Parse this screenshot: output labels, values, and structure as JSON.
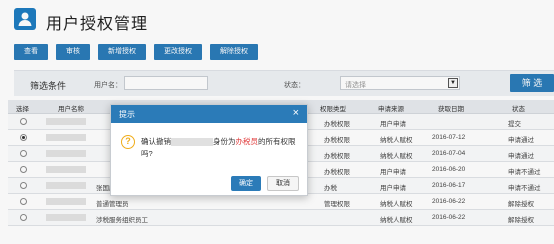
{
  "header": {
    "title": "用户授权管理"
  },
  "toolbar": {
    "buttons": [
      {
        "label": "查看"
      },
      {
        "label": "审核"
      },
      {
        "label": "新增授权"
      },
      {
        "label": "更改授权"
      },
      {
        "label": "解除授权"
      }
    ]
  },
  "filter": {
    "title": "筛选条件",
    "username_label": "用户名：",
    "username_value": "",
    "status_label": "状态：",
    "status_value": "请选择",
    "button": "筛 选"
  },
  "table": {
    "headers": [
      "选择",
      "用户名称",
      "",
      "",
      "",
      "",
      "权限类型",
      "申请来源",
      "获取日期",
      "状态"
    ],
    "rows": [
      {
        "selected": false,
        "name": "",
        "col3": "",
        "perm": "办税权限",
        "source": "用户申请",
        "date": "",
        "status": "提交"
      },
      {
        "selected": true,
        "name": "",
        "col3": "",
        "perm": "办税权限",
        "source": "纳税人赋权",
        "date": "2016-07-12",
        "status": "申请通过"
      },
      {
        "selected": false,
        "name": "",
        "col3": "",
        "perm": "办税权限",
        "source": "纳税人赋权",
        "date": "2016-07-04",
        "status": "申请通过"
      },
      {
        "selected": false,
        "name": "",
        "col3": "",
        "perm": "办税权限",
        "source": "用户申请",
        "date": "2016-06-20",
        "status": "申请不通过"
      },
      {
        "selected": false,
        "name": "",
        "col3": "张国庆",
        "perm": "办税",
        "source": "用户申请",
        "date": "2016-06-17",
        "status": "申请不通过"
      },
      {
        "selected": false,
        "name": "",
        "col3": "普通管理员",
        "perm": "管理权限",
        "source": "纳税人赋权",
        "date": "2016-06-22",
        "status": "解除授权"
      },
      {
        "selected": false,
        "name": "",
        "col3": "涉税服务组织员工",
        "perm": "",
        "source": "纳税人赋权",
        "date": "2016-06-22",
        "status": "解除授权"
      }
    ]
  },
  "dialog": {
    "title": "提示",
    "close": "×",
    "icon": "?",
    "msg_prefix": "确认撤销",
    "msg_mid": "身份为",
    "msg_role": "办税员",
    "msg_suffix": "的所有权限吗?",
    "ok": "确定",
    "cancel": "取消"
  }
}
